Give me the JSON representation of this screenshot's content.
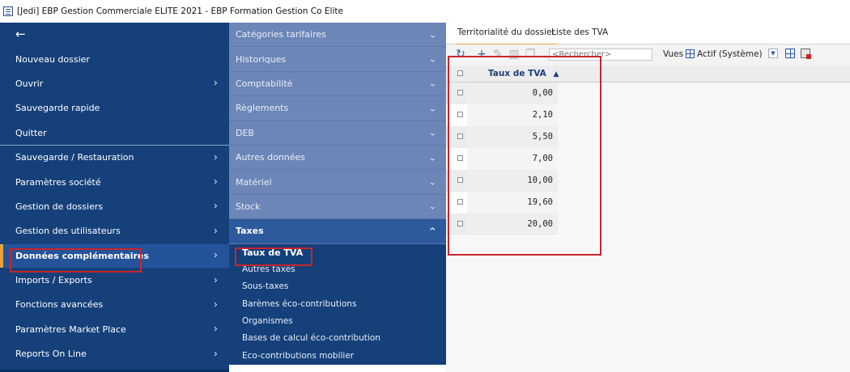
{
  "window": {
    "title": "[Jedi] EBP Gestion Commerciale ELITE 2021 - EBP Formation Gestion Co Elite"
  },
  "left_menu": {
    "back_symbol": "←",
    "items": [
      {
        "label": "Nouveau dossier",
        "chevron": ""
      },
      {
        "label": "Ouvrir",
        "chevron": "›"
      },
      {
        "label": "Sauvegarde rapide",
        "chevron": ""
      },
      {
        "label": "Quitter",
        "chevron": ""
      },
      {
        "label": "Sauvegarde / Restauration",
        "chevron": "›"
      },
      {
        "label": "Paramètres société",
        "chevron": "›"
      },
      {
        "label": "Gestion de dossiers",
        "chevron": "›"
      },
      {
        "label": "Gestion des utilisateurs",
        "chevron": "›"
      },
      {
        "label": "Données complémentaires",
        "chevron": "›"
      },
      {
        "label": "Imports / Exports",
        "chevron": "›"
      },
      {
        "label": "Fonctions avancées",
        "chevron": "›"
      },
      {
        "label": "Paramètres Market Place",
        "chevron": "›"
      },
      {
        "label": "Reports On Line",
        "chevron": "›"
      }
    ]
  },
  "mid_menu": {
    "sections": [
      {
        "label": "Catégories tarifaires",
        "chevron": "⌄"
      },
      {
        "label": "Historiques",
        "chevron": "⌄"
      },
      {
        "label": "Comptabilité",
        "chevron": "⌄"
      },
      {
        "label": "Règlements",
        "chevron": "⌄"
      },
      {
        "label": "DEB",
        "chevron": "⌄"
      },
      {
        "label": "Autres données",
        "chevron": "⌄"
      },
      {
        "label": "Matériel",
        "chevron": "⌄"
      },
      {
        "label": "Stock",
        "chevron": "⌄"
      }
    ],
    "expanded": {
      "label": "Taxes",
      "chevron": "^"
    },
    "sub_items": [
      "Taux de TVA",
      "Autres taxes",
      "Sous-taxes",
      "Barèmes éco-contributions",
      "Organismes",
      "Bases de calcul éco-contribution",
      "Eco-contributions mobilier"
    ]
  },
  "right_panel": {
    "tabs": [
      "Territorialité du dossier",
      "Liste des TVA"
    ],
    "toolbar": {
      "search_placeholder": "<Rechercher>",
      "vues_label": "Vues",
      "vue_selected": "Actif (Système)"
    },
    "table": {
      "header": "Taux de TVA",
      "sort_symbol": "▲",
      "rows": [
        "0,00",
        "2,10",
        "5,50",
        "7,00",
        "10,00",
        "19,60",
        "20,00"
      ]
    }
  }
}
